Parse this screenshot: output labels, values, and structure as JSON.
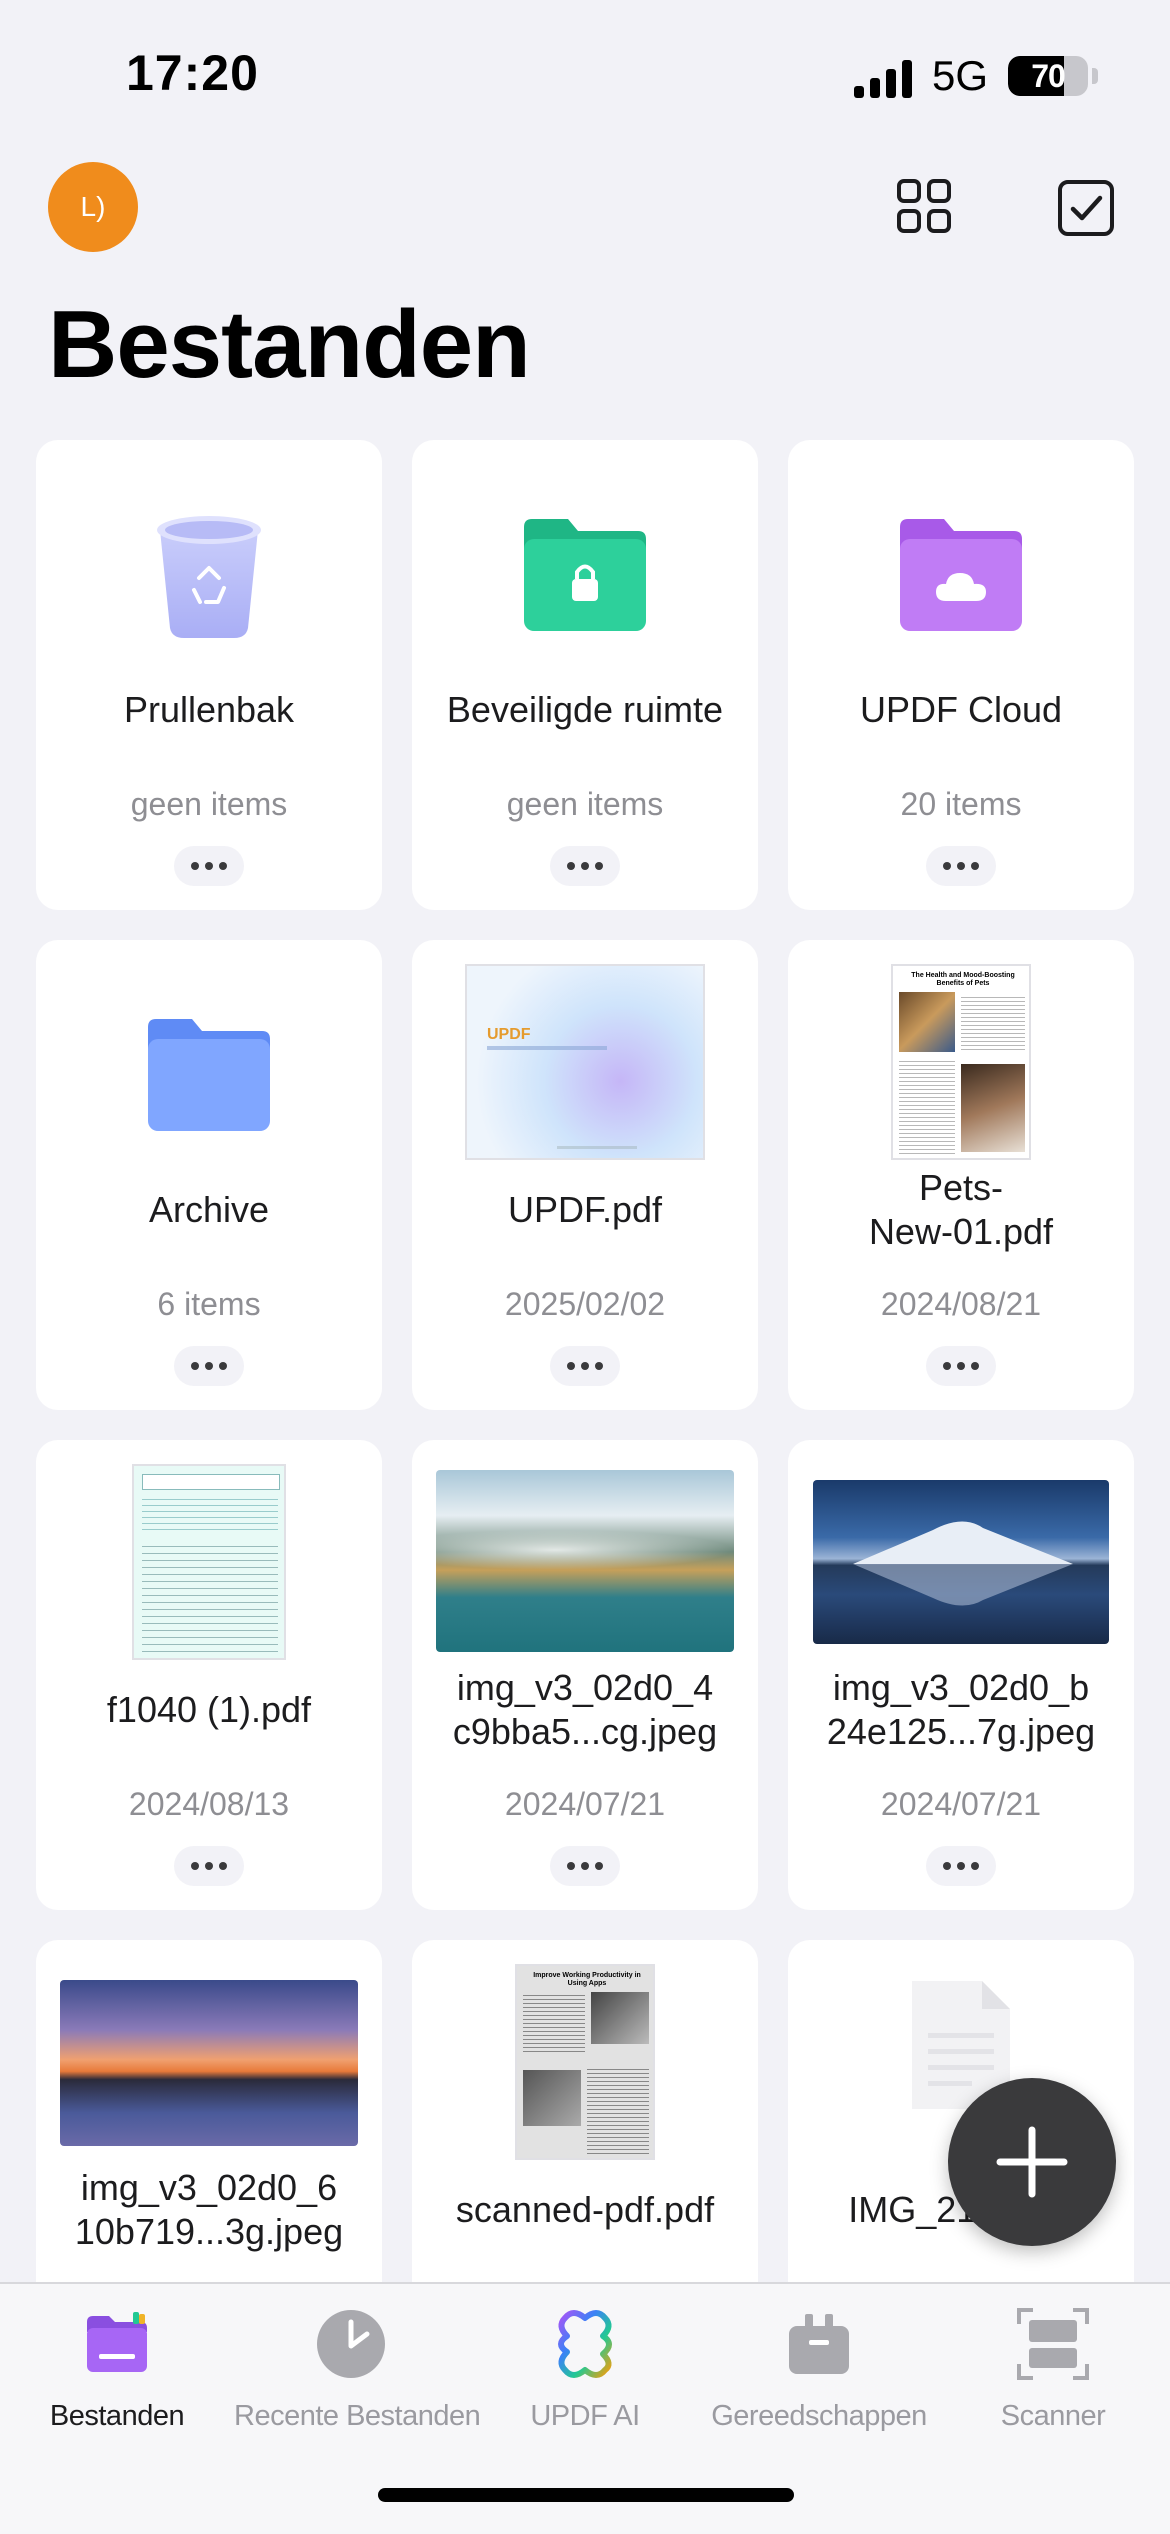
{
  "status_bar": {
    "time": "17:20",
    "network": "5G",
    "battery": "70",
    "battery_level": 0.7
  },
  "header": {
    "avatar_initials": "L)",
    "title": "Bestanden"
  },
  "files": [
    {
      "name": "Prullenbak",
      "sub": "geen items",
      "kind": "trash"
    },
    {
      "name": "Beveiligde ruimte",
      "sub": "geen items",
      "kind": "secure-folder"
    },
    {
      "name": "UPDF Cloud",
      "sub": "20 items",
      "kind": "cloud-folder"
    },
    {
      "name": "Archive",
      "sub": "6 items",
      "kind": "folder"
    },
    {
      "name": "UPDF.pdf",
      "sub": "2025/02/02",
      "kind": "pdf",
      "thumb_text": "UPDF"
    },
    {
      "name": "Pets-\nNew-01.pdf",
      "sub": "2024/08/21",
      "kind": "pdf",
      "thumb_text": "The Health and Mood-Boosting Benefits of Pets"
    },
    {
      "name": "f1040 (1).pdf",
      "sub": "2024/08/13",
      "kind": "pdf"
    },
    {
      "name": "img_v3_02d0_4\nc9bba5...cg.jpeg",
      "sub": "2024/07/21",
      "kind": "image"
    },
    {
      "name": "img_v3_02d0_b\n24e125...7g.jpeg",
      "sub": "2024/07/21",
      "kind": "image"
    },
    {
      "name": "img_v3_02d0_6\n10b719...3g.jpeg",
      "sub": "",
      "kind": "image"
    },
    {
      "name": "scanned-pdf.pdf",
      "sub": "",
      "kind": "pdf",
      "thumb_text": "Improve Working Productivity in Using Apps"
    },
    {
      "name": "IMG_2110.pdf",
      "sub": "",
      "kind": "pdf"
    }
  ],
  "tabs": [
    {
      "label": "Bestanden",
      "icon": "folder-icon",
      "active": true
    },
    {
      "label": "Recente Bestanden",
      "icon": "clock-icon",
      "active": false
    },
    {
      "label": "UPDF AI",
      "icon": "ai-icon",
      "active": false
    },
    {
      "label": "Gereedschappen",
      "icon": "toolbox-icon",
      "active": false
    },
    {
      "label": "Scanner",
      "icon": "scanner-icon",
      "active": false
    }
  ],
  "colors": {
    "accent": "#a855f7",
    "avatar": "#f08c1c",
    "secure": "#22c993",
    "folder": "#7aa0ff"
  }
}
